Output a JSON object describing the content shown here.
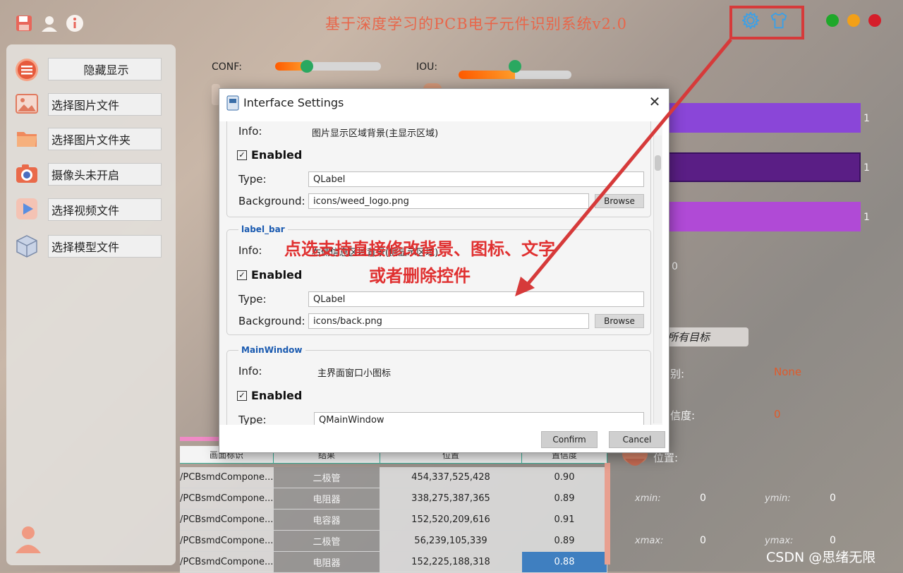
{
  "app": {
    "title": "基于深度学习的PCB电子元件识别系统v2.0"
  },
  "sidebar": {
    "items": [
      {
        "label": "隐藏显示",
        "icon": "menu-icon"
      },
      {
        "label": "选择图片文件",
        "icon": "image-icon"
      },
      {
        "label": "选择图片文件夹",
        "icon": "folder-icon"
      },
      {
        "label": "摄像头未开启",
        "icon": "camera-icon"
      },
      {
        "label": "选择视频文件",
        "icon": "video-icon"
      },
      {
        "label": "选择模型文件",
        "icon": "model-icon"
      }
    ]
  },
  "sliders": {
    "conf": {
      "label": "CONF:",
      "value": 0.3
    },
    "iou": {
      "label": "IOU:",
      "value": 0.5
    }
  },
  "right_panel": {
    "bar_values": [
      "1",
      "1",
      "1"
    ],
    "bar_colors": [
      "#8a46d8",
      "#5a1e85",
      "#b04ad6"
    ],
    "count_value": "0",
    "target_select_label": "所有目标",
    "type_label": "别:",
    "type_value": "None",
    "confidence_label": "信度:",
    "confidence_value": "0",
    "position_label": "位置:",
    "xmin_label": "xmin:",
    "xmin_value": "0",
    "ymin_label": "ymin:",
    "ymin_value": "0",
    "xmax_label": "xmax:",
    "xmax_value": "0",
    "ymax_label": "ymax:",
    "ymax_value": "0"
  },
  "table": {
    "headers": [
      "画面标识",
      "结果",
      "位置",
      "置信度"
    ],
    "rows": [
      [
        "/PCBsmdCompone...",
        "二极管",
        "454,337,525,428",
        "0.90"
      ],
      [
        "/PCBsmdCompone...",
        "电阻器",
        "338,275,387,365",
        "0.89"
      ],
      [
        "/PCBsmdCompone...",
        "电容器",
        "152,520,209,616",
        "0.91"
      ],
      [
        "/PCBsmdCompone...",
        "二极管",
        "56,239,105,339",
        "0.89"
      ],
      [
        "/PCBsmdCompone...",
        "电阻器",
        "152,225,188,318",
        "0.88"
      ]
    ]
  },
  "dialog": {
    "title": "Interface Settings",
    "groups": [
      {
        "title": "",
        "info_label": "Info:",
        "info": "图片显示区域背景(主显示区域)",
        "enabled_label": "Enabled",
        "type_label": "Type:",
        "type": "QLabel",
        "background_label": "Background:",
        "background": "icons/weed_logo.png",
        "browse_label": "Browse"
      },
      {
        "title": "label_bar",
        "info_label": "Info:",
        "info": "右侧信息区域背景(侧显示区域)",
        "enabled_label": "Enabled",
        "type_label": "Type:",
        "type": "QLabel",
        "background_label": "Background:",
        "background": "icons/back.png",
        "browse_label": "Browse"
      },
      {
        "title": "MainWindow",
        "info_label": "Info:",
        "info": "主界面窗口小图标",
        "enabled_label": "Enabled",
        "type_label": "Type:",
        "type": "QMainWindow"
      }
    ],
    "confirm_label": "Confirm",
    "cancel_label": "Cancel"
  },
  "annotation": {
    "line1": "点选支持直接修改背景、图标、文字",
    "line2": "或者删除控件",
    "color": "#e03030"
  },
  "watermark": "CSDN @思绪无限"
}
